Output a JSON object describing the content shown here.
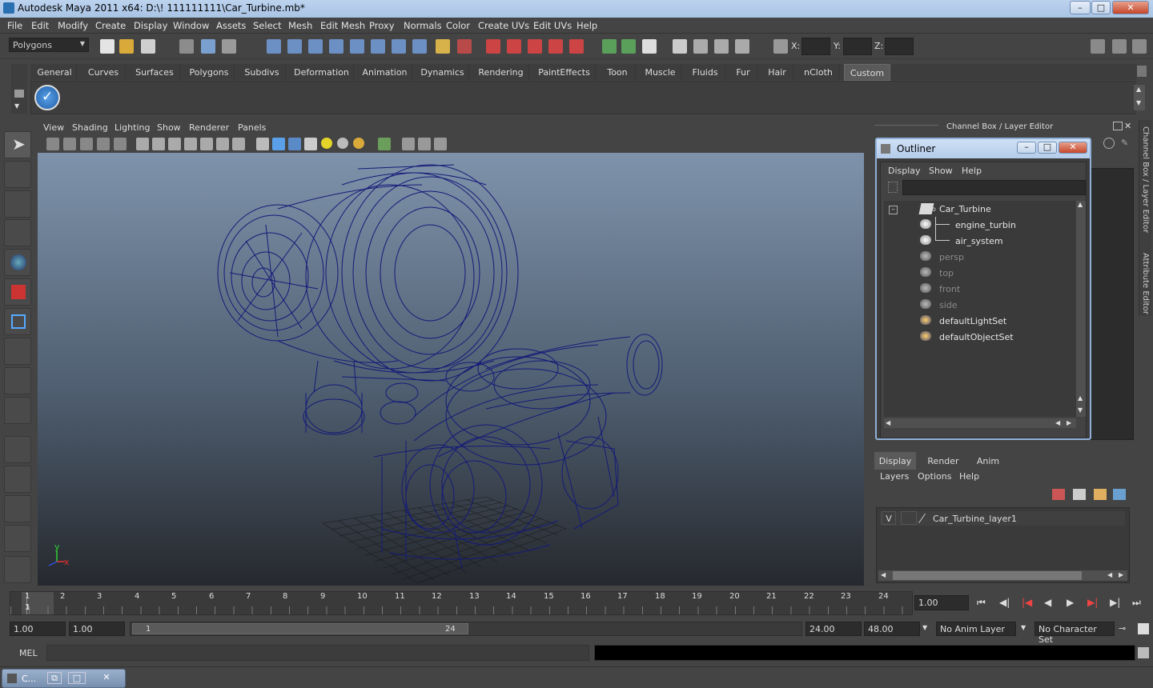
{
  "window": {
    "title": "Autodesk Maya 2011 x64: D:\\! 111111111\\Car_Turbine.mb*"
  },
  "menubar": [
    "File",
    "Edit",
    "Modify",
    "Create",
    "Display",
    "Window",
    "Assets",
    "Select",
    "Mesh",
    "Edit Mesh",
    "Proxy",
    "Normals",
    "Color",
    "Create UVs",
    "Edit UVs",
    "Help"
  ],
  "statusline": {
    "mode": "Polygons",
    "x_label": "X:",
    "y_label": "Y:",
    "z_label": "Z:"
  },
  "shelf_tabs": [
    "General",
    "Curves",
    "Surfaces",
    "Polygons",
    "Subdivs",
    "Deformation",
    "Animation",
    "Dynamics",
    "Rendering",
    "PaintEffects",
    "Toon",
    "Muscle",
    "Fluids",
    "Fur",
    "Hair",
    "nCloth",
    "Custom"
  ],
  "shelf_active": "Custom",
  "viewport_menu": [
    "View",
    "Shading",
    "Lighting",
    "Show",
    "Renderer",
    "Panels"
  ],
  "axis": {
    "x": "x",
    "y": "y"
  },
  "channel_box_title": "Channel Box / Layer Editor",
  "side_tabs": {
    "channel_box": "Channel Box / Layer Editor",
    "attribute_editor": "Attribute Editor"
  },
  "outliner": {
    "title": "Outliner",
    "menu": [
      "Display",
      "Show",
      "Help"
    ],
    "items": [
      {
        "label": "Car_Turbine",
        "dim": false
      },
      {
        "label": "engine_turbin",
        "dim": false
      },
      {
        "label": "air_system",
        "dim": false
      },
      {
        "label": "persp",
        "dim": true
      },
      {
        "label": "top",
        "dim": true
      },
      {
        "label": "front",
        "dim": true
      },
      {
        "label": "side",
        "dim": true
      },
      {
        "label": "defaultLightSet",
        "dim": false
      },
      {
        "label": "defaultObjectSet",
        "dim": false
      }
    ]
  },
  "layer_editor": {
    "tabs": [
      "Display",
      "Render",
      "Anim"
    ],
    "menu": [
      "Layers",
      "Options",
      "Help"
    ],
    "layer": {
      "visible": "V",
      "name": "Car_Turbine_layer1"
    }
  },
  "timeline": {
    "ticks": [
      "1",
      "2",
      "3",
      "4",
      "5",
      "6",
      "7",
      "8",
      "9",
      "10",
      "11",
      "12",
      "13",
      "14",
      "15",
      "16",
      "17",
      "18",
      "19",
      "20",
      "21",
      "22",
      "23",
      "24"
    ],
    "current_frame_marker": "1",
    "current_time": "1.00"
  },
  "range": {
    "start": "1.00",
    "playback_start": "1.00",
    "slider_start": "1",
    "slider_end": "24",
    "playback_end": "24.00",
    "end": "48.00",
    "anim_layer": "No Anim Layer",
    "character_set": "No Character Set"
  },
  "mel": {
    "label": "MEL"
  },
  "taskbar": {
    "label": "C..."
  },
  "colors": {
    "wire": "#141a78",
    "accent": "#8fb1d9",
    "bg": "#444444"
  }
}
